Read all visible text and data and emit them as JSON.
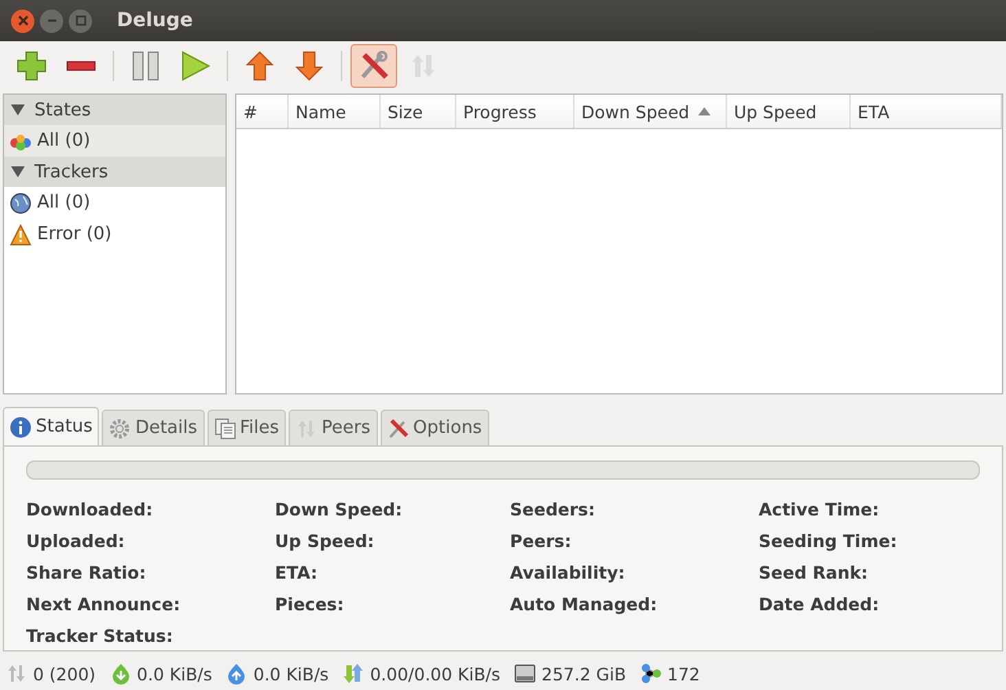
{
  "window": {
    "title": "Deluge"
  },
  "toolbar": [
    {
      "kind": "add",
      "pressed": false,
      "disabled": false
    },
    {
      "kind": "remove",
      "pressed": false,
      "disabled": false
    },
    {
      "kind": "separator"
    },
    {
      "kind": "pause",
      "pressed": false,
      "disabled": false
    },
    {
      "kind": "resume",
      "pressed": false,
      "disabled": false
    },
    {
      "kind": "separator"
    },
    {
      "kind": "up",
      "pressed": false,
      "disabled": false
    },
    {
      "kind": "down",
      "pressed": false,
      "disabled": false
    },
    {
      "kind": "separator"
    },
    {
      "kind": "preferences",
      "pressed": true,
      "disabled": false
    },
    {
      "kind": "connection",
      "pressed": false,
      "disabled": true
    }
  ],
  "sidebar": {
    "groups": [
      {
        "label": "States",
        "expanded": true,
        "items": [
          {
            "label": "All (0)",
            "kind": "states",
            "selected": true
          }
        ]
      },
      {
        "label": "Trackers",
        "expanded": true,
        "items": [
          {
            "label": "All (0)",
            "kind": "globe",
            "selected": false
          },
          {
            "label": "Error (0)",
            "kind": "warning",
            "selected": false
          }
        ]
      }
    ]
  },
  "table": {
    "columns": [
      {
        "label": "#",
        "sorted": false
      },
      {
        "label": "Name",
        "sorted": false
      },
      {
        "label": "Size",
        "sorted": false
      },
      {
        "label": "Progress",
        "sorted": false
      },
      {
        "label": "Down Speed",
        "sorted": true
      },
      {
        "label": "Up Speed",
        "sorted": false
      },
      {
        "label": "ETA",
        "sorted": false
      }
    ]
  },
  "tabs": [
    {
      "label": "Status",
      "kind": "info",
      "selected": true
    },
    {
      "label": "Details",
      "kind": "gear",
      "selected": false
    },
    {
      "label": "Files",
      "kind": "files",
      "selected": false
    },
    {
      "label": "Peers",
      "kind": "peers",
      "selected": false
    },
    {
      "label": "Options",
      "kind": "tools",
      "selected": false
    }
  ],
  "status": {
    "progress": {
      "level": 0
    },
    "columns": [
      [
        "Downloaded:",
        "Uploaded:",
        "Share Ratio:",
        "Next Announce:",
        "Tracker Status:"
      ],
      [
        "Down Speed:",
        "Up Speed:",
        "ETA:",
        "Pieces:"
      ],
      [
        "Seeders:",
        "Peers:",
        "Availability:",
        "Auto Managed:"
      ],
      [
        "Active Time:",
        "Seeding Time:",
        "Seed Rank:",
        "Date Added:"
      ]
    ]
  },
  "status_bar": [
    {
      "kind": "connections",
      "text": "0 (200)"
    },
    {
      "kind": "download",
      "text": "0.0 KiB/s"
    },
    {
      "kind": "upload",
      "text": "0.0 KiB/s"
    },
    {
      "kind": "traffic",
      "text": "0.00/0.00 KiB/s"
    },
    {
      "kind": "disk",
      "text": "257.2 GiB"
    },
    {
      "kind": "dht",
      "text": "172"
    }
  ]
}
